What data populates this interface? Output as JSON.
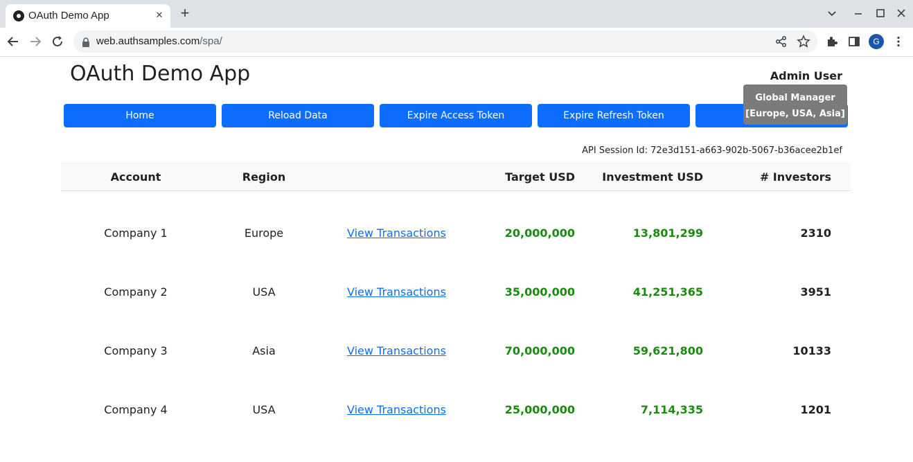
{
  "browser": {
    "tab_title": "OAuth Demo App",
    "url_host": "web.authsamples.com",
    "url_path": "/spa/",
    "profile_initial": "G"
  },
  "app": {
    "title": "OAuth Demo App",
    "user_name": "Admin User",
    "tooltip": {
      "line1": "Global Manager",
      "line2": "[Europe, USA, Asia]"
    },
    "buttons": [
      "Home",
      "Reload Data",
      "Expire Access Token",
      "Expire Refresh Token",
      ""
    ],
    "session_id": "API Session Id: 72e3d151-a663-902b-5067-b36acee2b1ef"
  },
  "table": {
    "headers": [
      "Account",
      "Region",
      "",
      "Target USD",
      "Investment USD",
      "# Investors"
    ],
    "rows": [
      {
        "account": "Company 1",
        "region": "Europe",
        "link": "View Transactions",
        "target": "20,000,000",
        "investment": "13,801,299",
        "investors": "2310"
      },
      {
        "account": "Company 2",
        "region": "USA",
        "link": "View Transactions",
        "target": "35,000,000",
        "investment": "41,251,365",
        "investors": "3951"
      },
      {
        "account": "Company 3",
        "region": "Asia",
        "link": "View Transactions",
        "target": "70,000,000",
        "investment": "59,621,800",
        "investors": "10133"
      },
      {
        "account": "Company 4",
        "region": "USA",
        "link": "View Transactions",
        "target": "25,000,000",
        "investment": "7,114,335",
        "investors": "1201"
      }
    ]
  },
  "colors": {
    "primary": "#0d6efd",
    "money": "#1a8a12",
    "tooltip_bg": "#7b7b7b"
  }
}
